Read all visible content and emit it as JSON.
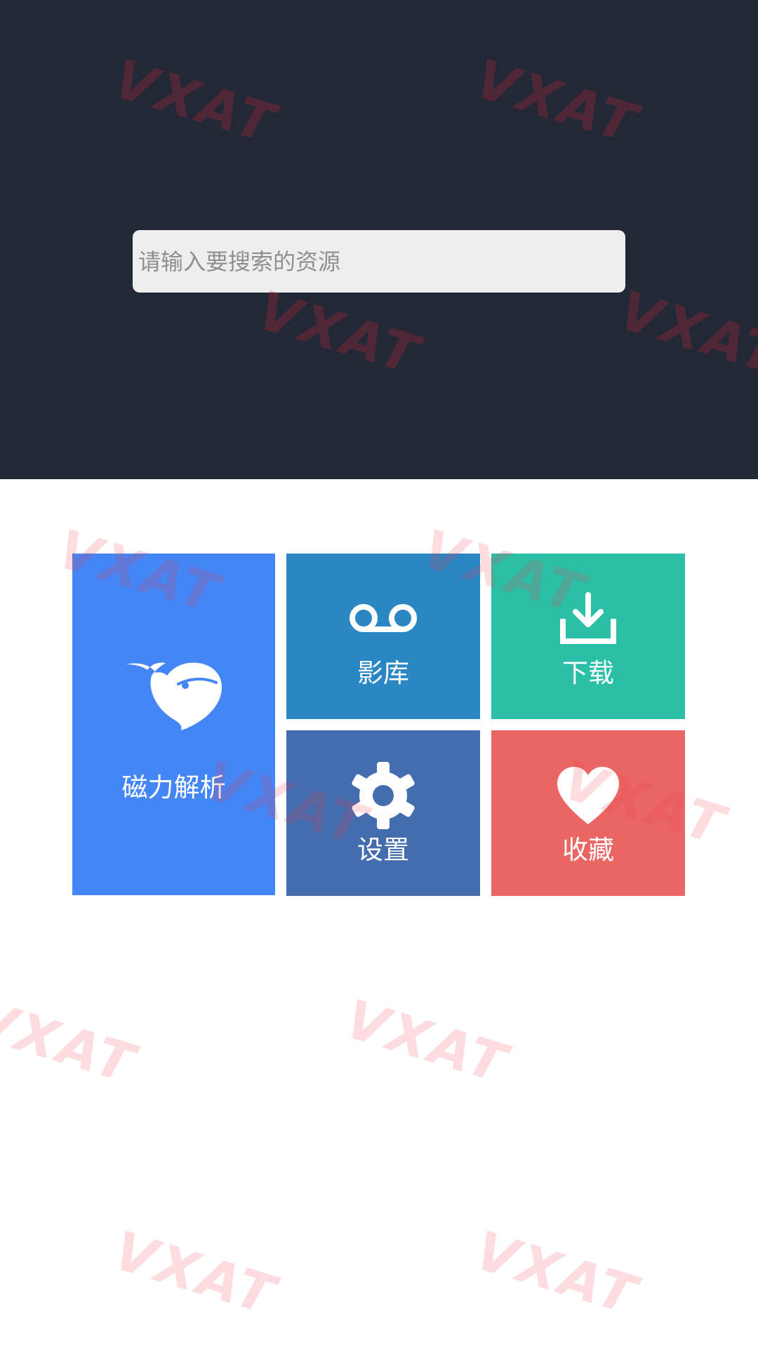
{
  "search": {
    "placeholder": "请输入要搜索的资源",
    "value": ""
  },
  "tiles": {
    "magnet": {
      "label": "磁力解析",
      "icon": "whale-icon",
      "color": "#4486F5"
    },
    "library": {
      "label": "影库",
      "icon": "voicemail-icon",
      "color": "#2B86C4"
    },
    "download": {
      "label": "下载",
      "icon": "download-icon",
      "color": "#2BBFA8"
    },
    "settings": {
      "label": "设置",
      "icon": "gear-icon",
      "color": "#436DAE"
    },
    "favorites": {
      "label": "收藏",
      "icon": "heart-icon",
      "color": "#E96663"
    }
  },
  "colors": {
    "header_background": "#222835",
    "page_background": "#FFFFFF",
    "search_background": "#EEEEEE",
    "watermark": "#E8384F"
  },
  "watermark": {
    "text": "VXAT"
  }
}
